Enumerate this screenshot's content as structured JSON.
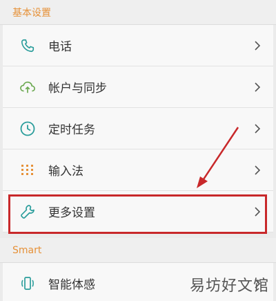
{
  "sections": [
    {
      "header": "基本设置",
      "items": [
        {
          "label": "电话",
          "icon": "phone-icon"
        },
        {
          "label": "帐户与同步",
          "icon": "cloud-sync-icon"
        },
        {
          "label": "定时任务",
          "icon": "clock-icon"
        },
        {
          "label": "输入法",
          "icon": "keypad-icon"
        },
        {
          "label": "更多设置",
          "icon": "wrench-icon"
        }
      ]
    },
    {
      "header": "Smart",
      "items": [
        {
          "label": "智能体感",
          "icon": "motion-phone-icon"
        }
      ]
    }
  ],
  "watermark": "易坊好文馆",
  "colors": {
    "header_text": "#e69138",
    "accent_teal": "#2a9d9b",
    "accent_green": "#6aa84f",
    "highlight": "#c8282a"
  }
}
